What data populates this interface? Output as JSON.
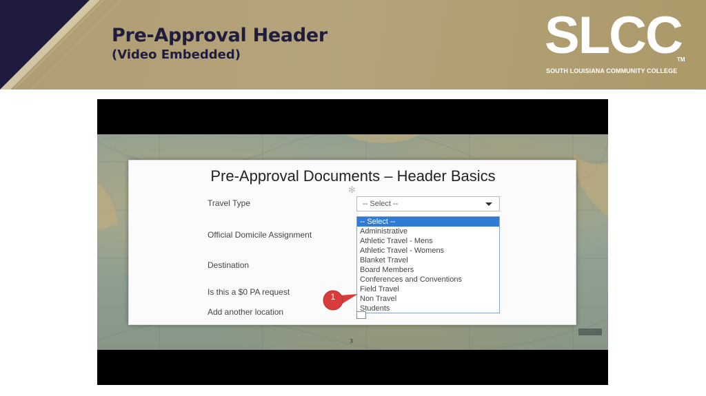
{
  "slide": {
    "title": "Pre-Approval Header",
    "subtitle": "(Video Embedded)"
  },
  "logo": {
    "name": "SLCC",
    "trademark": "TM",
    "tagline": "SOUTH LOUISIANA COMMUNITY COLLEGE"
  },
  "video": {
    "document_title": "Pre-Approval Documents – Header Basics",
    "fields": {
      "travel_type": "Travel Type",
      "official_domicile": "Official Domicile Assignment",
      "destination": "Destination",
      "zero_pa": "Is this a $0 PA request",
      "add_location": "Add another location"
    },
    "select_value": "-- Select --",
    "dropdown_options": [
      "-- Select --",
      "Administrative",
      "Athletic Travel - Mens",
      "Athletic Travel - Womens",
      "Blanket Travel",
      "Board Members",
      "Conferences and Conventions",
      "Field Travel",
      "Non Travel",
      "Students"
    ],
    "callout_number": "1",
    "timestamp": "3"
  },
  "colors": {
    "banner": "#b1a073",
    "navy": "#1f1c3d",
    "callout": "#d93d3b",
    "selected": "#2f7bd6"
  }
}
